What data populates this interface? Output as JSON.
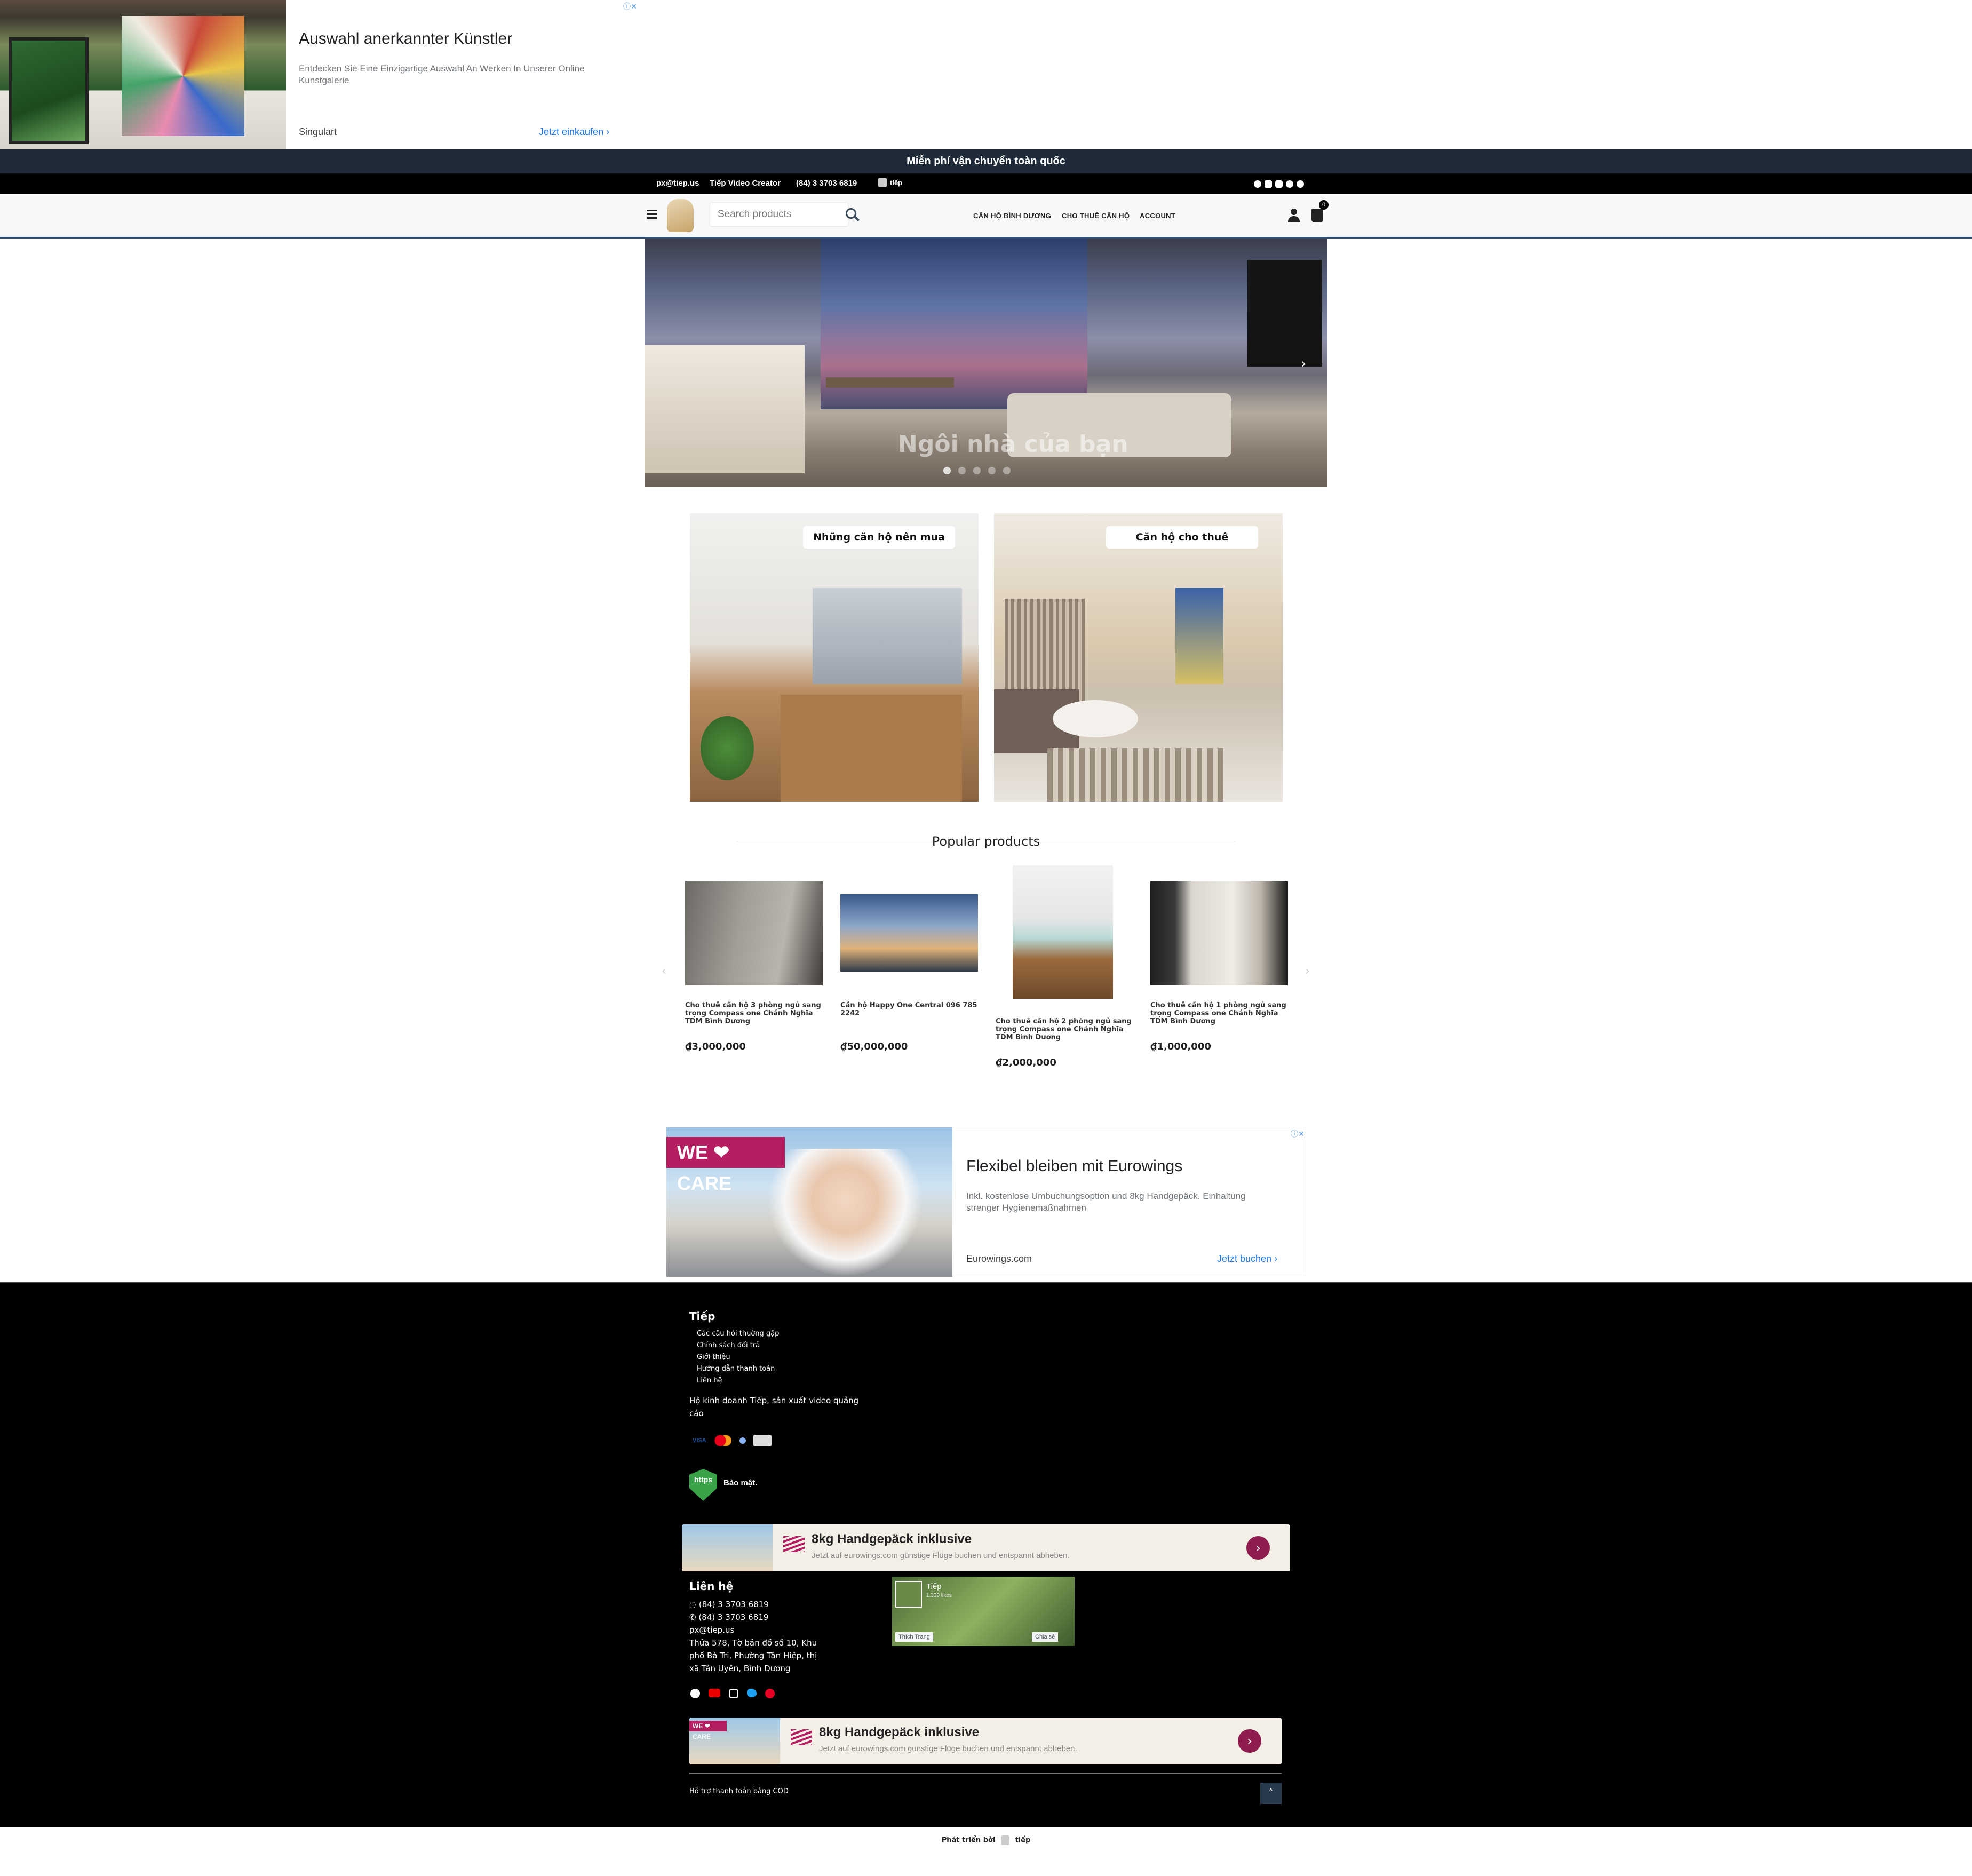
{
  "top_ad": {
    "title": "Auswahl anerkannter Künstler",
    "description": "Entdecken Sie Eine Einzigartige Auswahl An Werken In Unserer Online Kunstgalerie",
    "site": "Singulart",
    "cta": "Jetzt einkaufen"
  },
  "announcement": "Miễn phí vận chuyển toàn quốc",
  "topbar": {
    "email": "px@tiep.us",
    "creator": "Tiếp Video Creator",
    "phone": "(84) 3 3703 6819",
    "brand": "tiếp"
  },
  "header": {
    "search_placeholder": "Search products",
    "nav": [
      "CĂN HỘ BÌNH DƯƠNG",
      "CHO THUÊ CĂN HỘ",
      "ACCOUNT"
    ],
    "cart_count": "0"
  },
  "hero": {
    "caption": "Ngôi nhà của bạn"
  },
  "categories": [
    {
      "label": "Những căn hộ nên mua"
    },
    {
      "label": "Căn hộ cho thuê"
    }
  ],
  "popular": {
    "title": "Popular products",
    "products": [
      {
        "name": "Cho thuê căn hộ 3 phòng ngủ sang trọng Compass one Chánh Nghĩa TDM Bình Dương",
        "price": "₫3,000,000"
      },
      {
        "name": "Căn hộ Happy One Central 096 785 2242",
        "price": "₫50,000,000"
      },
      {
        "name": "Cho thuê căn hộ 2 phòng ngủ sang trọng Compass one Chánh Nghĩa TDM Bình Dương",
        "price": "₫2,000,000"
      },
      {
        "name": "Cho thuê căn hộ 1 phòng ngủ sang trọng Compass one Chánh Nghĩa TDM Bình Dương",
        "price": "₫1,000,000"
      }
    ]
  },
  "mid_ad": {
    "badge": "WE ❤ CARE",
    "title": "Flexibel bleiben mit Eurowings",
    "description": "Inkl. kostenlose Umbuchungsoption und 8kg Handgepäck. Einhaltung strenger Hygienemaßnahmen",
    "site": "Eurowings.com",
    "cta": "Jetzt buchen"
  },
  "footer": {
    "brand_heading": "Tiếp",
    "links": [
      "Các câu hỏi thường gặp",
      "Chính sách đổi trả",
      "Giới thiệu",
      "Hướng dẫn thanh toán",
      "Liên hệ"
    ],
    "about": "Hộ kinh doanh Tiếp, sản xuất video quảng cáo",
    "payments": [
      "VISA",
      "mastercard",
      "paypal",
      "cod"
    ],
    "secure_badge": "https",
    "secure_label": "Bảo mật.",
    "banner_ad": {
      "title": "8kg Handgepäck inklusive",
      "description": "Jetzt auf eurowings.com günstige Flüge buchen und entspannt abheben."
    },
    "contact_heading": "Liên hệ",
    "whatsapp": "(84) 3 3703 6819",
    "phone": "(84) 3 3703 6819",
    "email": "px@tiep.us",
    "address": "Thửa 578, Tờ bản đồ số 10, Khu phố Bà Tri, Phường Tân Hiệp, thị xã Tân Uyên, Bình Dương",
    "fb_page": {
      "name": "Tiếp",
      "likes": "1.339 likes",
      "like_btn": "Thích Trang",
      "share_btn": "Chia sẻ"
    },
    "bottom_ad": {
      "badge": "WE ❤ CARE",
      "title": "8kg Handgepäck inklusive",
      "description": "Jetzt auf eurowings.com günstige Flüge buchen und entspannt abheben."
    },
    "cod_note": "Hỗ trợ thanh toán bằng COD"
  },
  "credit": {
    "prefix": "Phát triển bởi",
    "brand": "tiếp"
  },
  "colors": {
    "header_border": "#2d4d74",
    "announcement_bg": "#1f2b38",
    "footer_bg": "#000000",
    "ad_cta": "#1a73e8"
  }
}
